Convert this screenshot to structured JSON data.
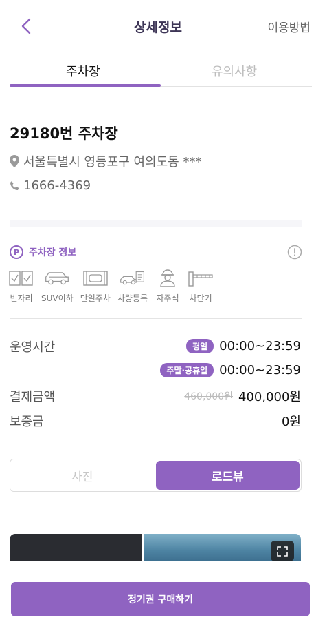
{
  "header": {
    "title": "상세정보",
    "right_link": "이용방법"
  },
  "tabs": [
    {
      "label": "주차장",
      "active": true
    },
    {
      "label": "유의사항",
      "active": false
    }
  ],
  "lot": {
    "name": "29180번 주차장",
    "address": "서울특별시 영등포구 여의도동 ***",
    "phone": "1666-4369"
  },
  "info": {
    "badge": "P",
    "title": "주차장 정보",
    "features": [
      {
        "label": "빈자리",
        "icon": "checkbox-slots-icon"
      },
      {
        "label": "SUV이하",
        "icon": "suv-icon"
      },
      {
        "label": "단일주차",
        "icon": "single-parking-icon"
      },
      {
        "label": "차량등록",
        "icon": "car-register-icon"
      },
      {
        "label": "자주식",
        "icon": "self-parking-attendant-icon"
      },
      {
        "label": "차단기",
        "icon": "barrier-gate-icon"
      }
    ]
  },
  "details": {
    "hours_label": "운영시간",
    "weekday_pill": "평일",
    "weekday_time": "00:00~23:59",
    "weekend_pill": "주말·공휴일",
    "weekend_time": "00:00~23:59",
    "payment_label": "결제금액",
    "old_price": "460,000원",
    "price": "400,000원",
    "deposit_label": "보증금",
    "deposit": "0원"
  },
  "media_toggle": {
    "photo": "사진",
    "roadview": "로드뷰",
    "active": "roadview"
  },
  "cta": {
    "label": "정기권 구매하기"
  },
  "colors": {
    "accent": "#8f63c1",
    "title": "#3d3556"
  }
}
